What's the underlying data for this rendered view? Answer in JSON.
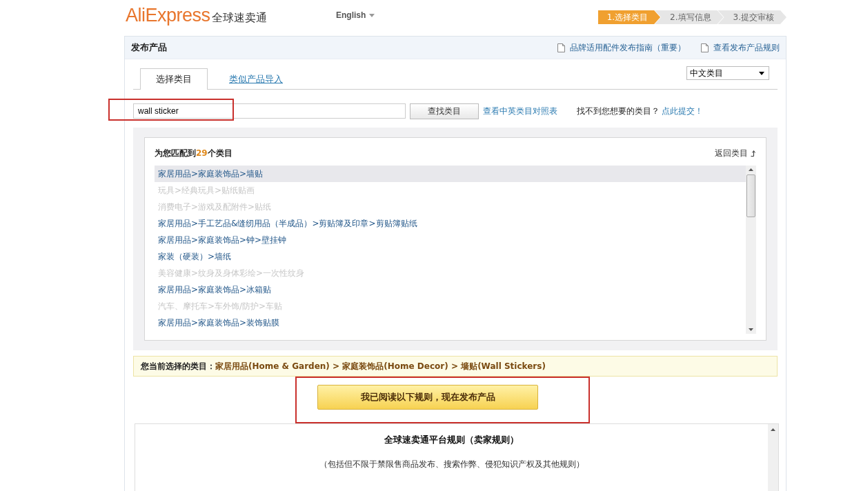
{
  "header": {
    "logo": {
      "brand": "AliExpress",
      "tagline": "全球速卖通"
    },
    "language": "English",
    "steps": [
      {
        "label": "1.选择类目",
        "selected": true
      },
      {
        "label": "2.填写信息",
        "selected": false
      },
      {
        "label": "3.提交审核",
        "selected": false
      }
    ]
  },
  "panel": {
    "title": "发布产品",
    "links": [
      "品牌适用配件发布指南（重要）",
      "查看发布产品规则"
    ]
  },
  "tabs": [
    {
      "label": "选择类目",
      "selected": true
    },
    {
      "label": "类似产品导入",
      "selected": false
    }
  ],
  "category_language": "中文类目",
  "search": {
    "value": "wall sticker",
    "highlighted": true,
    "button": "查找类目",
    "mapping_link": "查看中英类目对照表",
    "missing_text": "找不到您想要的类目？",
    "missing_link": "点此提交！"
  },
  "results": {
    "prefix": "为您匹配到",
    "count": "29",
    "suffix": "个类目",
    "back": "返回类目",
    "items": [
      {
        "text": "家居用品>家庭装饰品>墙贴",
        "selected": true,
        "disabled": false
      },
      {
        "text": "玩具>经典玩具>贴纸贴画",
        "selected": false,
        "disabled": true
      },
      {
        "text": "消费电子>游戏及配附件>贴纸",
        "selected": false,
        "disabled": true
      },
      {
        "text": "家居用品>手工艺品&缝纫用品（半成品）>剪贴簿及印章>剪贴簿贴纸",
        "selected": false,
        "disabled": false
      },
      {
        "text": "家居用品>家庭装饰品>钟>壁挂钟",
        "selected": false,
        "disabled": false
      },
      {
        "text": "家装（硬装）>墙纸",
        "selected": false,
        "disabled": false
      },
      {
        "text": "美容健康>纹身及身体彩绘>一次性纹身",
        "selected": false,
        "disabled": true
      },
      {
        "text": "家居用品>家庭装饰品>冰箱贴",
        "selected": false,
        "disabled": false
      },
      {
        "text": "汽车、摩托车>车外饰/防护>车贴",
        "selected": false,
        "disabled": true
      },
      {
        "text": "家居用品>家庭装饰品>装饰贴膜",
        "selected": false,
        "disabled": false
      }
    ]
  },
  "current": {
    "label": "您当前选择的类目：",
    "path": "家居用品(Home & Garden) > 家庭装饰品(Home Decor) > 墙贴(Wall Stickers)"
  },
  "publish_button": {
    "label": "我已阅读以下规则，现在发布产品",
    "highlighted": true
  },
  "rules": {
    "title": "全球速卖通平台规则（卖家规则）",
    "subtitle": "（包括但不限于禁限售商品发布、搜索作弊、侵犯知识产权及其他规则）"
  }
}
